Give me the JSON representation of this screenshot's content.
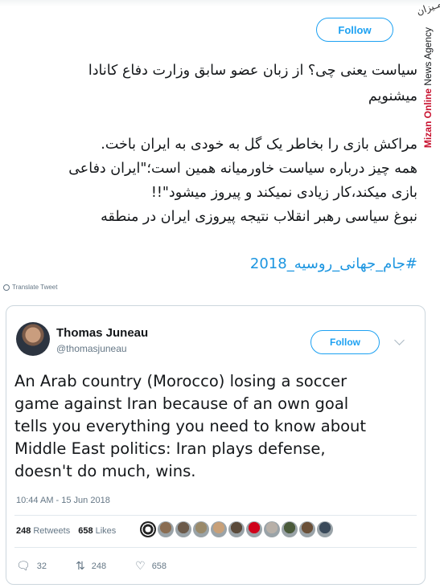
{
  "watermark": {
    "brand": "Mizan Online",
    "suffix": " News Agency"
  },
  "header": {
    "follow_label": "Follow"
  },
  "tweet": {
    "lines": [
      "سیاست یعنی چی؟ از زبان عضو سابق وزارت دفاع کانادا",
      "میشنویم",
      "مراکش بازی را بخاطر یک گل به خودی به ایران باخت.",
      "همه چیز درباره سیاست خاورمیانه همین است؛\"ایران دفاعی",
      "بازی میکند،کار زیادی نمیکند و پیروز میشود\"!!",
      "نبوغ سیاسی رهبر انقلاب نتیجه پیروزی ایران در منطقه"
    ],
    "hashtag": "#جام_جهانی_روسیه_2018",
    "translate_label": "Translate Tweet"
  },
  "quoted": {
    "name": "Thomas Juneau",
    "handle": "@thomasjuneau",
    "follow_label": "Follow",
    "text_lines": [
      "An Arab country (Morocco) losing a soccer",
      "game against Iran because of an own goal",
      "tells you everything you need to know about",
      "Middle East politics: Iran plays defense,",
      "doesn't do much, wins."
    ],
    "timestamp": "10:44 AM - 15 Jun 2018",
    "retweets_count": "248",
    "retweets_label": "Retweets",
    "likes_count": "658",
    "likes_label": "Likes",
    "actions": {
      "reply_icon": "reply-icon",
      "reply_count": "32",
      "retweet_icon": "retweet-icon",
      "retweet_count": "248",
      "like_icon": "heart-icon",
      "like_count": "658"
    },
    "liker_colors": [
      "#222222",
      "#8a6d52",
      "#6b5a4a",
      "#9a8a6a",
      "#c8a078",
      "#5a4a3a",
      "#d0021b",
      "#b8b0a8",
      "#4a5a3a",
      "#6a5038",
      "#3a4a5a"
    ]
  },
  "colors": {
    "accent": "#1da1f2",
    "hashtag": "#1b95e0",
    "watermark_red": "#c8102e"
  }
}
